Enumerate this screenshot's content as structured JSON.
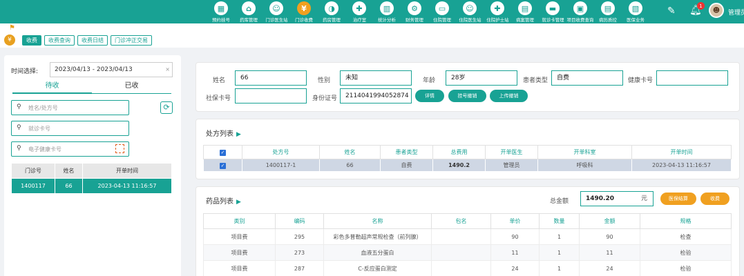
{
  "nav": [
    {
      "label": "预约挂号",
      "icon": "calendar-icon",
      "glyph": "▦"
    },
    {
      "label": "药库管理",
      "icon": "house-icon",
      "glyph": "⌂"
    },
    {
      "label": "门诊医生站",
      "icon": "doctor-icon",
      "glyph": "☺"
    },
    {
      "label": "门诊收费",
      "icon": "yen-icon",
      "glyph": "¥"
    },
    {
      "label": "药房管理",
      "icon": "pill-icon",
      "glyph": "◑"
    },
    {
      "label": "治疗室",
      "icon": "nurse-icon",
      "glyph": "✚"
    },
    {
      "label": "统计分析",
      "icon": "chart-icon",
      "glyph": "▥"
    },
    {
      "label": "财务管理",
      "icon": "gear-icon",
      "glyph": "⚙"
    },
    {
      "label": "住院管理",
      "icon": "bed-icon",
      "glyph": "▭"
    },
    {
      "label": "住院医生站",
      "icon": "doctor-icon",
      "glyph": "☺"
    },
    {
      "label": "住院护士站",
      "icon": "nurse-icon",
      "glyph": "✚"
    },
    {
      "label": "病案管理",
      "icon": "folder-icon",
      "glyph": "▤"
    },
    {
      "label": "就诊卡管理",
      "icon": "card-icon",
      "glyph": "▬"
    },
    {
      "label": "项目收费查询",
      "icon": "search-doc-icon",
      "glyph": "▣"
    },
    {
      "label": "病历质控",
      "icon": "clipboard-icon",
      "glyph": "▤"
    },
    {
      "label": "医保业务",
      "icon": "id-card-icon",
      "glyph": "▧"
    }
  ],
  "header": {
    "badge_count": "1",
    "username": "管理员",
    "avatar_glyph": "☻"
  },
  "subtabs": [
    "收费",
    "收费查询",
    "收费日结",
    "门诊冲正交易"
  ],
  "left": {
    "time_label": "时间选择:",
    "time_value": "2023/04/13 - 2023/04/13",
    "clear_glyph": "×",
    "tab_pending": "待收",
    "tab_done": "已收",
    "search_name_placeholder": "姓名/处方号",
    "search_card_placeholder": "就诊卡号",
    "search_ehealth_placeholder": "电子健康卡号",
    "table": {
      "headers": [
        "门诊号",
        "姓名",
        "开单时间"
      ],
      "rows": [
        [
          "1400117",
          "66",
          "2023-04-13 11:16:57"
        ]
      ]
    }
  },
  "patient": {
    "name_label": "姓名",
    "name": "66",
    "gender_label": "性别",
    "gender": "未知",
    "age_label": "年龄",
    "age": "28岁",
    "type_label": "患者类型",
    "type": "自费",
    "health_card_label": "健康卡号",
    "health_card": "",
    "si_card_label": "社保卡号",
    "si_card": "",
    "id_label": "身份证号",
    "id_number": "2114041994052874",
    "btn_detail": "详情",
    "btn_cancel_reg": "挂号撤销",
    "btn_upload": "上传撤销"
  },
  "rx": {
    "title": "处方列表",
    "headers": [
      "处方号",
      "姓名",
      "患者类型",
      "总费用",
      "开单医生",
      "开单科室",
      "开单时间"
    ],
    "rows": [
      [
        "1400117-1",
        "66",
        "自费",
        "1490.2",
        "管理员",
        "呼吸科",
        "2023-04-13 11:16:57"
      ]
    ]
  },
  "drugs": {
    "title": "药品列表",
    "total_label": "总金额",
    "total": "1490.20",
    "unit": "元",
    "btn_settle": "医保结算",
    "btn_charge": "收费",
    "headers": [
      "类别",
      "编码",
      "名称",
      "包名",
      "单价",
      "数量",
      "金额",
      "规格"
    ],
    "rows": [
      [
        "项目费",
        "295",
        "彩色多普勒超声常规检查（前列腺）",
        "",
        "90",
        "1",
        "90",
        "检查"
      ],
      [
        "项目费",
        "273",
        "血液五分蛋白",
        "",
        "11",
        "1",
        "11",
        "检验"
      ],
      [
        "项目费",
        "287",
        "C-反应蛋白测定",
        "",
        "24",
        "1",
        "24",
        "检验"
      ]
    ]
  }
}
